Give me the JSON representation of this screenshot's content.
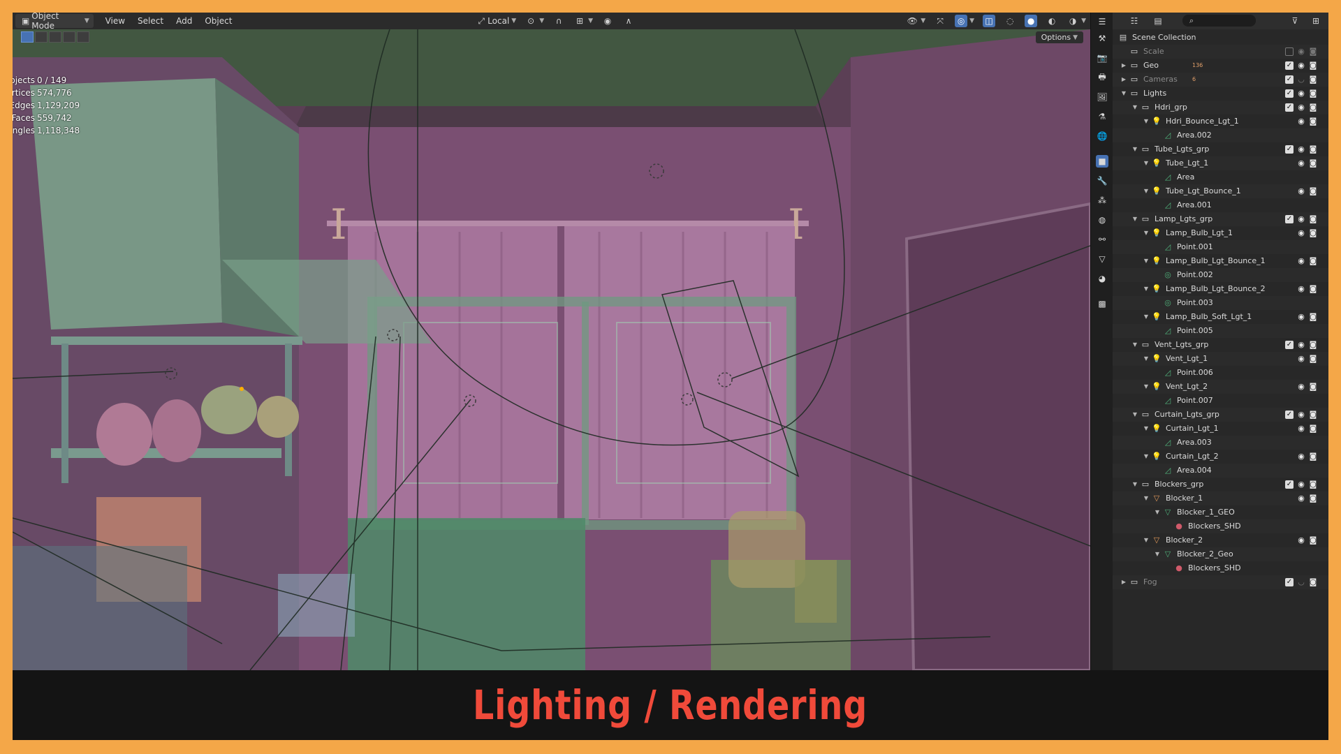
{
  "header": {
    "mode_label": "Object Mode",
    "menus": [
      "View",
      "Select",
      "Add",
      "Object"
    ],
    "transform_orientation": "Local",
    "options_label": "Options"
  },
  "stats": {
    "rows": [
      {
        "label": "Objects",
        "value": "0 / 149"
      },
      {
        "label": "Vertices",
        "value": "574,776"
      },
      {
        "label": "Edges",
        "value": "1,129,209"
      },
      {
        "label": "Faces",
        "value": "559,742"
      },
      {
        "label": "Triangles",
        "value": "1,118,348"
      }
    ]
  },
  "outliner": {
    "rows": [
      {
        "name": "Scene Collection",
        "level": 0,
        "type": "scene",
        "twisty": "",
        "visible": true,
        "checkbox": false,
        "eye": false,
        "cam": false,
        "dim": false
      },
      {
        "name": "Scale",
        "level": 1,
        "type": "collection",
        "twisty": "",
        "dim": true,
        "checkbox": "off",
        "eye": "dim",
        "cam": "dim"
      },
      {
        "name": "Geo",
        "level": 1,
        "type": "collection",
        "twisty": "right",
        "dim": false,
        "checkbox": "on",
        "eye": "on",
        "cam": "on",
        "badge": "136"
      },
      {
        "name": "Cameras",
        "level": 1,
        "type": "collection",
        "twisty": "right",
        "dim": true,
        "checkbox": "on",
        "eye": "off",
        "cam": "on",
        "badge": "6"
      },
      {
        "name": "Lights",
        "level": 1,
        "type": "collection",
        "twisty": "down",
        "dim": false,
        "checkbox": "on",
        "eye": "on",
        "cam": "on"
      },
      {
        "name": "Hdri_grp",
        "level": 2,
        "type": "collection",
        "twisty": "down",
        "checkbox": "on",
        "eye": "on",
        "cam": "on"
      },
      {
        "name": "Hdri_Bounce_Lgt_1",
        "level": 3,
        "type": "light",
        "twisty": "down",
        "eye": "on",
        "cam": "on"
      },
      {
        "name": "Area.002",
        "level": 4,
        "type": "lightdata",
        "twisty": ""
      },
      {
        "name": "Tube_Lgts_grp",
        "level": 2,
        "type": "collection",
        "twisty": "down",
        "checkbox": "on",
        "eye": "on",
        "cam": "on"
      },
      {
        "name": "Tube_Lgt_1",
        "level": 3,
        "type": "light",
        "twisty": "down",
        "eye": "on",
        "cam": "on"
      },
      {
        "name": "Area",
        "level": 4,
        "type": "lightdata",
        "twisty": ""
      },
      {
        "name": "Tube_Lgt_Bounce_1",
        "level": 3,
        "type": "light",
        "twisty": "down",
        "eye": "on",
        "cam": "on"
      },
      {
        "name": "Area.001",
        "level": 4,
        "type": "lightdata",
        "twisty": ""
      },
      {
        "name": "Lamp_Lgts_grp",
        "level": 2,
        "type": "collection",
        "twisty": "down",
        "checkbox": "on",
        "eye": "on",
        "cam": "on"
      },
      {
        "name": "Lamp_Bulb_Lgt_1",
        "level": 3,
        "type": "light",
        "twisty": "down",
        "eye": "on",
        "cam": "on"
      },
      {
        "name": "Point.001",
        "level": 4,
        "type": "lightdata",
        "twisty": ""
      },
      {
        "name": "Lamp_Bulb_Lgt_Bounce_1",
        "level": 3,
        "type": "light",
        "twisty": "down",
        "eye": "on",
        "cam": "on"
      },
      {
        "name": "Point.002",
        "level": 4,
        "type": "pointdata",
        "twisty": ""
      },
      {
        "name": "Lamp_Bulb_Lgt_Bounce_2",
        "level": 3,
        "type": "light",
        "twisty": "down",
        "eye": "on",
        "cam": "on"
      },
      {
        "name": "Point.003",
        "level": 4,
        "type": "pointdata",
        "twisty": ""
      },
      {
        "name": "Lamp_Bulb_Soft_Lgt_1",
        "level": 3,
        "type": "light",
        "twisty": "down",
        "eye": "on",
        "cam": "on"
      },
      {
        "name": "Point.005",
        "level": 4,
        "type": "lightdata",
        "twisty": ""
      },
      {
        "name": "Vent_Lgts_grp",
        "level": 2,
        "type": "collection",
        "twisty": "down",
        "checkbox": "on",
        "eye": "on",
        "cam": "on"
      },
      {
        "name": "Vent_Lgt_1",
        "level": 3,
        "type": "light",
        "twisty": "down",
        "eye": "on",
        "cam": "on"
      },
      {
        "name": "Point.006",
        "level": 4,
        "type": "lightdata",
        "twisty": ""
      },
      {
        "name": "Vent_Lgt_2",
        "level": 3,
        "type": "light",
        "twisty": "down",
        "eye": "on",
        "cam": "on"
      },
      {
        "name": "Point.007",
        "level": 4,
        "type": "lightdata",
        "twisty": ""
      },
      {
        "name": "Curtain_Lgts_grp",
        "level": 2,
        "type": "collection",
        "twisty": "down",
        "checkbox": "on",
        "eye": "on",
        "cam": "on"
      },
      {
        "name": "Curtain_Lgt_1",
        "level": 3,
        "type": "light",
        "twisty": "down",
        "eye": "on",
        "cam": "on"
      },
      {
        "name": "Area.003",
        "level": 4,
        "type": "lightdata",
        "twisty": ""
      },
      {
        "name": "Curtain_Lgt_2",
        "level": 3,
        "type": "light",
        "twisty": "down",
        "eye": "on",
        "cam": "on"
      },
      {
        "name": "Area.004",
        "level": 4,
        "type": "lightdata",
        "twisty": ""
      },
      {
        "name": "Blockers_grp",
        "level": 2,
        "type": "collection",
        "twisty": "down",
        "checkbox": "on",
        "eye": "on",
        "cam": "on"
      },
      {
        "name": "Blocker_1",
        "level": 3,
        "type": "mesh",
        "twisty": "down",
        "eye": "on",
        "cam": "on"
      },
      {
        "name": "Blocker_1_GEO",
        "level": 4,
        "type": "meshdata",
        "twisty": "down"
      },
      {
        "name": "Blockers_SHD",
        "level": 5,
        "type": "material",
        "twisty": ""
      },
      {
        "name": "Blocker_2",
        "level": 3,
        "type": "mesh",
        "twisty": "down",
        "eye": "on",
        "cam": "on"
      },
      {
        "name": "Blocker_2_Geo",
        "level": 4,
        "type": "meshdata",
        "twisty": "down"
      },
      {
        "name": "Blockers_SHD",
        "level": 5,
        "type": "material",
        "twisty": ""
      },
      {
        "name": "Fog",
        "level": 1,
        "type": "collection",
        "twisty": "right",
        "dim": true,
        "checkbox": "on",
        "eye": "off",
        "cam": "on",
        "badge_icon": "mesh"
      }
    ]
  },
  "caption": "Lighting / Rendering",
  "colors": {
    "border": "#f4a748",
    "accent": "#4772b3",
    "caption": "#f04a3a",
    "light_icon": "#e3a06a",
    "data_icon": "#4fb07a"
  }
}
